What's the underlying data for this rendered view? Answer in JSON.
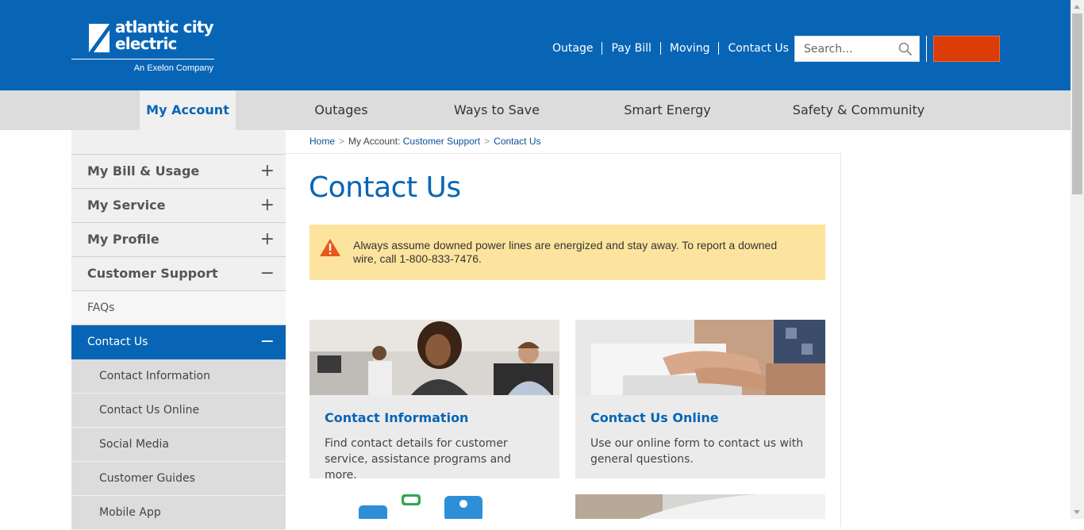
{
  "brand": {
    "name_line1": "atlantic city",
    "name_line2": "electric",
    "tagline": "An Exelon Company",
    "primary_color": "#0865b5",
    "accent_color": "#db3c08"
  },
  "utility_nav": [
    "Outage",
    "Pay Bill",
    "Moving",
    "Contact Us"
  ],
  "search": {
    "placeholder": "Search...",
    "icon": "search-icon"
  },
  "login_button": {
    "label": ""
  },
  "main_nav": [
    {
      "label": "My Account",
      "active": true
    },
    {
      "label": "Outages"
    },
    {
      "label": "Ways to Save"
    },
    {
      "label": "Smart Energy"
    },
    {
      "label": "Safety & Community"
    }
  ],
  "sidebar": {
    "items": [
      {
        "label": "My Bill & Usage",
        "toggle": "+"
      },
      {
        "label": "My Service",
        "toggle": "+"
      },
      {
        "label": "My Profile",
        "toggle": "+"
      },
      {
        "label": "Customer Support",
        "toggle": "−"
      },
      {
        "label": "FAQs"
      },
      {
        "label": "Contact Us",
        "toggle": "−"
      },
      {
        "label": "Contact Information"
      },
      {
        "label": "Contact Us Online"
      },
      {
        "label": "Social Media"
      },
      {
        "label": "Customer Guides"
      },
      {
        "label": "Mobile App"
      }
    ]
  },
  "breadcrumb": {
    "home": "Home",
    "section": "My Account:",
    "parent": "Customer Support",
    "current": "Contact Us",
    "separator": ">"
  },
  "page": {
    "title": "Contact Us",
    "alert_text": "Always assume downed power lines are energized and stay away. To report a downed wire, call 1-800-833-7476."
  },
  "cards": [
    {
      "title": "Contact Information",
      "description": "Find contact details for customer service, assistance programs and more."
    },
    {
      "title": "Contact Us Online",
      "description": "Use our online form to contact us with general questions."
    }
  ]
}
